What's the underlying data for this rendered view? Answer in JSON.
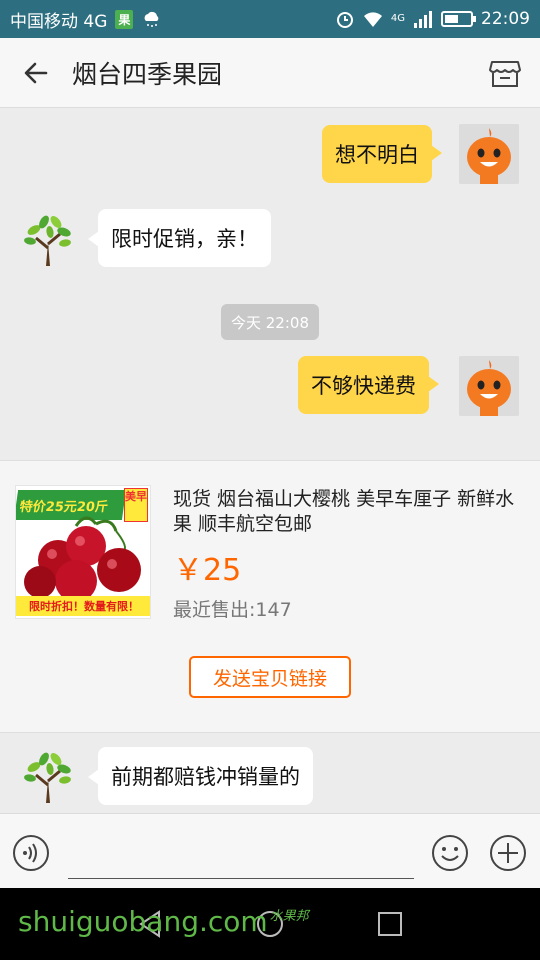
{
  "status_bar": {
    "carrier": "中国移动 4G",
    "badge": "果",
    "time": "22:09",
    "network_label": "4G",
    "battery_level": 0.55
  },
  "header": {
    "title": "烟台四季果园"
  },
  "messages": [
    {
      "side": "me",
      "text": "想不明白"
    },
    {
      "side": "them",
      "text": "限时促销，亲！"
    },
    {
      "side": "me",
      "text": "不够快递费"
    },
    {
      "side": "them",
      "text": "前期都赔钱冲销量的"
    }
  ],
  "timestamp": "今天 22:08",
  "product": {
    "title": "现货 烟台福山大樱桃  美早车厘子 新鲜水果 顺丰航空包邮",
    "price": "￥25",
    "sold": "最近售出:147",
    "image_banner": "特价25元20斤",
    "image_tag": "美早",
    "image_footer": "限时折扣！数量有限！",
    "send_button": "发送宝贝链接"
  },
  "watermark": "shuiguobang.com",
  "watermark_cn": "水果邦",
  "icons": [
    "back-arrow-icon",
    "store-icon",
    "voice-icon",
    "emoji-icon",
    "plus-icon",
    "nav-back-icon",
    "nav-home-icon",
    "nav-recents-icon"
  ],
  "colors": {
    "accent": "#ff6600",
    "my_bubble": "#ffd54a",
    "status_bar": "#2d6f80"
  }
}
